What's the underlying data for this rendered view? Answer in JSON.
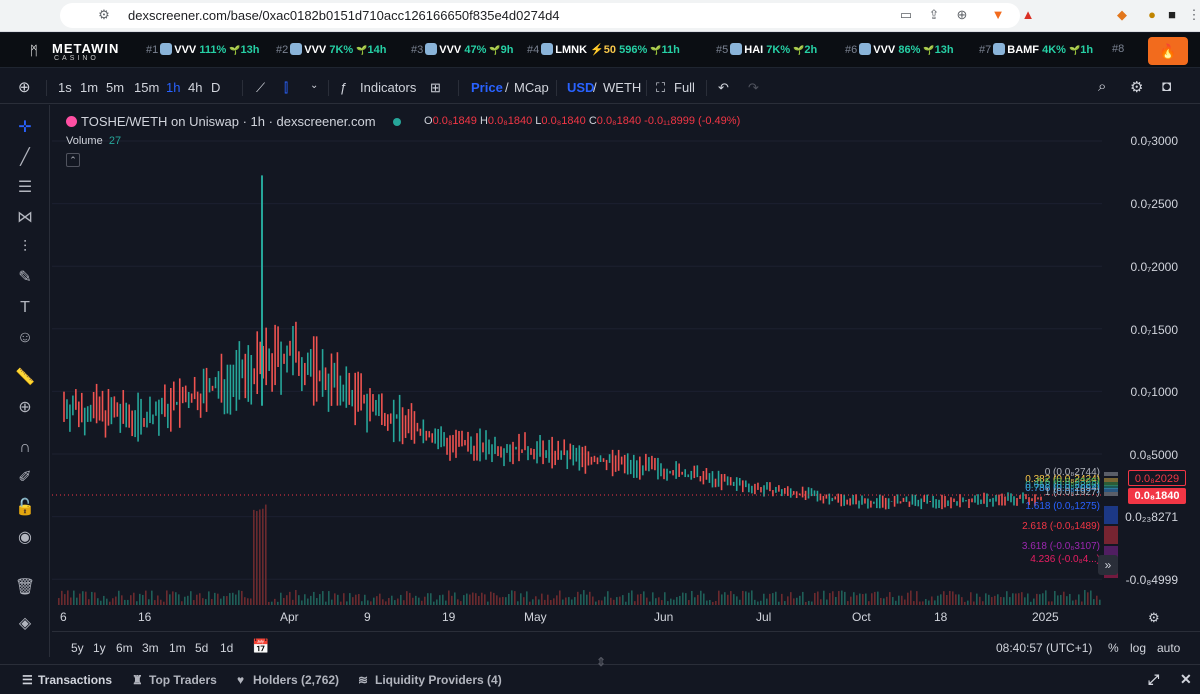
{
  "browser": {
    "url": "dexscreener.com/base/0xac0182b0151d710acc126166650f835e4d0274d4",
    "notif_badge": "1"
  },
  "trending": {
    "brand_name": "METAWIN",
    "brand_sub": "CASINO",
    "items": [
      {
        "rank": "#1",
        "token": "VVV",
        "change": "111%",
        "age": "13h"
      },
      {
        "rank": "#2",
        "token": "VVV",
        "change": "7K%",
        "age": "14h"
      },
      {
        "rank": "#3",
        "token": "VVV",
        "change": "47%",
        "age": "9h"
      },
      {
        "rank": "#4",
        "token": "LMNK",
        "boost": "⚡50",
        "change": "596%",
        "age": "11h"
      },
      {
        "rank": "#5",
        "token": "HAI",
        "change": "7K%",
        "age": "2h"
      },
      {
        "rank": "#6",
        "token": "VVV",
        "change": "86%",
        "age": "13h"
      },
      {
        "rank": "#7",
        "token": "BAMF",
        "change": "4K%",
        "age": "1h"
      },
      {
        "rank": "#8",
        "token": "",
        "change": "",
        "age": ""
      }
    ]
  },
  "toolbar": {
    "intervals": [
      "1s",
      "1m",
      "5m",
      "15m",
      "1h",
      "4h",
      "D"
    ],
    "active_interval": "1h",
    "indicators_label": "Indicators",
    "price_label": "Price",
    "mcap_label": "MCap",
    "usd_label": "USD",
    "weth_label": "WETH",
    "full_label": "Full"
  },
  "chart": {
    "legend_title": "TOSHE/WETH on Uniswap · 1h · dexscreener.com",
    "ohlc": {
      "o": "0.0₈1849",
      "h": "0.0₈1840",
      "l": "0.0₈1840",
      "c": "0.0₈1840",
      "chg": "-0.0₁₁8999 (-0.49%)"
    },
    "volume_label": "Volume",
    "volume_value": "27",
    "y_ticks": [
      "0.0₇3000",
      "0.0₇2500",
      "0.0₇2000",
      "0.0₇1500",
      "0.0₇1000",
      "0.0₈5000",
      "0.0₂₃8271",
      "-0.0₈4999"
    ],
    "x_ticks": [
      "6",
      "16",
      "Apr",
      "9",
      "19",
      "May",
      "Jun",
      "Jul",
      "Oct",
      "18",
      "2025"
    ],
    "fib_levels": [
      {
        "label": "0 (0.0₈2744)",
        "color": "#b2b5be"
      },
      {
        "label": "0.382 (0.0₈2424)",
        "color": "#f7c74a"
      },
      {
        "label": "0.5 (0.0₈2325)",
        "color": "#4caf50"
      },
      {
        "label": "0.618 (0.0₈2226)",
        "color": "#26a69a"
      },
      {
        "label": "0.786 (0.0₈2094)",
        "color": "#42a5f5"
      },
      {
        "label": "1 (0.0₈1927)",
        "color": "#b2b5be"
      },
      {
        "label": "1.618 (0.0₉1275)",
        "color": "#2962ff"
      },
      {
        "label": "2.618 (-0.0₉1489)",
        "color": "#f23645"
      },
      {
        "label": "3.618 (-0.0₈3107)",
        "color": "#9c27b0"
      },
      {
        "label": "4.236 (-0.0₈4...)",
        "color": "#e91e63"
      }
    ],
    "price_tag_outline": "0.0₈2029",
    "price_tag_current": "0.0₈1840",
    "chart_data": {
      "type": "line",
      "x": [
        "6",
        "16",
        "Apr",
        "9",
        "19",
        "May",
        "Jun",
        "Jul",
        "Oct",
        "18",
        "2025"
      ],
      "series": [
        {
          "values": [
            9e-09,
            8e-09,
            1.3e-08,
            9e-09,
            6e-09,
            5.5e-09,
            4e-09,
            2.5e-09,
            1.5e-09,
            1.5e-09,
            1.8e-09
          ]
        }
      ],
      "ylim": [
        -5e-09,
        3e-08
      ],
      "title": "",
      "xlabel": "",
      "ylabel": ""
    }
  },
  "range": {
    "buttons": [
      "5y",
      "1y",
      "6m",
      "3m",
      "1m",
      "5d",
      "1d"
    ],
    "time": "08:40:57 (UTC+1)",
    "pct": "%",
    "log": "log",
    "auto": "auto"
  },
  "tabs": {
    "transactions": "Transactions",
    "top_traders": "Top Traders",
    "holders": "Holders (2,762)",
    "liquidity": "Liquidity Providers (4)"
  }
}
